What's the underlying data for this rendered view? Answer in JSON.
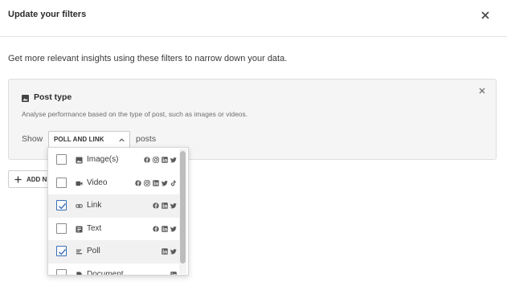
{
  "header": {
    "title": "Update your filters",
    "close_icon": "close-icon"
  },
  "subtitle": "Get more relevant insights using these filters to narrow down your data.",
  "filter_card": {
    "title": "Post type",
    "icon": "image-icon",
    "description": "Analyse performance based on the type of post, such as images or videos.",
    "show_label": "Show",
    "select_value": "POLL AND LINK",
    "posts_label": "posts"
  },
  "add_button": {
    "label": "ADD NEW FILTER"
  },
  "dropdown": {
    "options": [
      {
        "label": "Image(s)",
        "checked": false,
        "icon": "image-icon",
        "networks": [
          "facebook",
          "instagram",
          "linkedin",
          "twitter"
        ]
      },
      {
        "label": "Video",
        "checked": false,
        "icon": "video-icon",
        "networks": [
          "facebook",
          "instagram",
          "linkedin",
          "twitter",
          "tiktok"
        ]
      },
      {
        "label": "Link",
        "checked": true,
        "icon": "link-icon",
        "networks": [
          "facebook",
          "linkedin",
          "twitter"
        ]
      },
      {
        "label": "Text",
        "checked": false,
        "icon": "text-icon",
        "networks": [
          "facebook",
          "linkedin",
          "twitter"
        ]
      },
      {
        "label": "Poll",
        "checked": true,
        "icon": "poll-icon",
        "networks": [
          "linkedin",
          "twitter"
        ]
      },
      {
        "label": "Document",
        "checked": false,
        "icon": "document-icon",
        "networks": [
          "linkedin"
        ]
      }
    ]
  },
  "colors": {
    "check_blue": "#3a6fb5",
    "selected_row": "#f1f1f1",
    "card_bg": "#f5f5f5"
  }
}
